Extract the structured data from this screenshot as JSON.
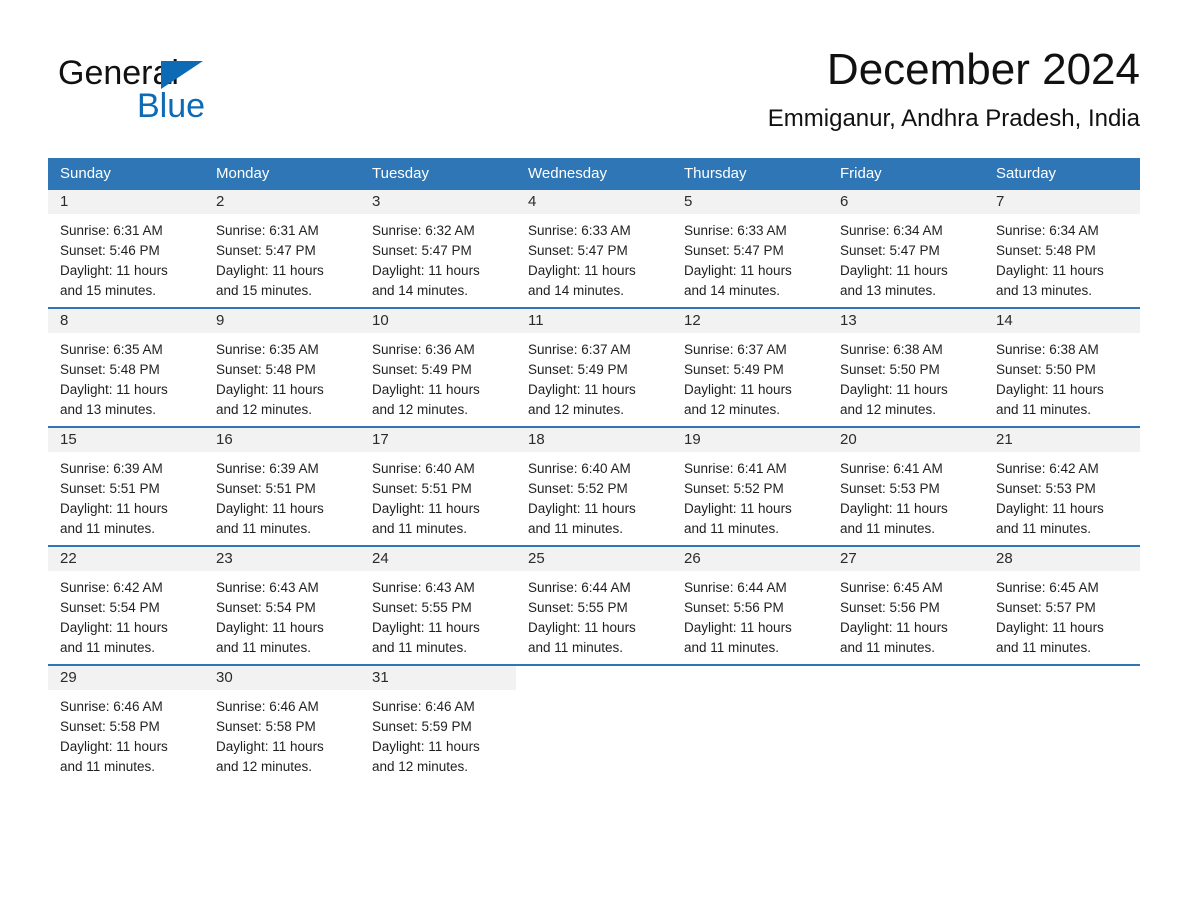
{
  "brand": {
    "line1": "General",
    "line2": "Blue",
    "triangle_color": "#0d6ab5"
  },
  "header": {
    "title": "December 2024",
    "subtitle": "Emmiganur, Andhra Pradesh, India"
  },
  "theme": {
    "header_blue": "#2e76b6",
    "daynum_band": "#f2f2f2",
    "text": "#1f1f1f"
  },
  "weekdays": [
    "Sunday",
    "Monday",
    "Tuesday",
    "Wednesday",
    "Thursday",
    "Friday",
    "Saturday"
  ],
  "weeks": [
    [
      {
        "day": "1",
        "sunrise": "Sunrise: 6:31 AM",
        "sunset": "Sunset: 5:46 PM",
        "daylight1": "Daylight: 11 hours",
        "daylight2": "and 15 minutes."
      },
      {
        "day": "2",
        "sunrise": "Sunrise: 6:31 AM",
        "sunset": "Sunset: 5:47 PM",
        "daylight1": "Daylight: 11 hours",
        "daylight2": "and 15 minutes."
      },
      {
        "day": "3",
        "sunrise": "Sunrise: 6:32 AM",
        "sunset": "Sunset: 5:47 PM",
        "daylight1": "Daylight: 11 hours",
        "daylight2": "and 14 minutes."
      },
      {
        "day": "4",
        "sunrise": "Sunrise: 6:33 AM",
        "sunset": "Sunset: 5:47 PM",
        "daylight1": "Daylight: 11 hours",
        "daylight2": "and 14 minutes."
      },
      {
        "day": "5",
        "sunrise": "Sunrise: 6:33 AM",
        "sunset": "Sunset: 5:47 PM",
        "daylight1": "Daylight: 11 hours",
        "daylight2": "and 14 minutes."
      },
      {
        "day": "6",
        "sunrise": "Sunrise: 6:34 AM",
        "sunset": "Sunset: 5:47 PM",
        "daylight1": "Daylight: 11 hours",
        "daylight2": "and 13 minutes."
      },
      {
        "day": "7",
        "sunrise": "Sunrise: 6:34 AM",
        "sunset": "Sunset: 5:48 PM",
        "daylight1": "Daylight: 11 hours",
        "daylight2": "and 13 minutes."
      }
    ],
    [
      {
        "day": "8",
        "sunrise": "Sunrise: 6:35 AM",
        "sunset": "Sunset: 5:48 PM",
        "daylight1": "Daylight: 11 hours",
        "daylight2": "and 13 minutes."
      },
      {
        "day": "9",
        "sunrise": "Sunrise: 6:35 AM",
        "sunset": "Sunset: 5:48 PM",
        "daylight1": "Daylight: 11 hours",
        "daylight2": "and 12 minutes."
      },
      {
        "day": "10",
        "sunrise": "Sunrise: 6:36 AM",
        "sunset": "Sunset: 5:49 PM",
        "daylight1": "Daylight: 11 hours",
        "daylight2": "and 12 minutes."
      },
      {
        "day": "11",
        "sunrise": "Sunrise: 6:37 AM",
        "sunset": "Sunset: 5:49 PM",
        "daylight1": "Daylight: 11 hours",
        "daylight2": "and 12 minutes."
      },
      {
        "day": "12",
        "sunrise": "Sunrise: 6:37 AM",
        "sunset": "Sunset: 5:49 PM",
        "daylight1": "Daylight: 11 hours",
        "daylight2": "and 12 minutes."
      },
      {
        "day": "13",
        "sunrise": "Sunrise: 6:38 AM",
        "sunset": "Sunset: 5:50 PM",
        "daylight1": "Daylight: 11 hours",
        "daylight2": "and 12 minutes."
      },
      {
        "day": "14",
        "sunrise": "Sunrise: 6:38 AM",
        "sunset": "Sunset: 5:50 PM",
        "daylight1": "Daylight: 11 hours",
        "daylight2": "and 11 minutes."
      }
    ],
    [
      {
        "day": "15",
        "sunrise": "Sunrise: 6:39 AM",
        "sunset": "Sunset: 5:51 PM",
        "daylight1": "Daylight: 11 hours",
        "daylight2": "and 11 minutes."
      },
      {
        "day": "16",
        "sunrise": "Sunrise: 6:39 AM",
        "sunset": "Sunset: 5:51 PM",
        "daylight1": "Daylight: 11 hours",
        "daylight2": "and 11 minutes."
      },
      {
        "day": "17",
        "sunrise": "Sunrise: 6:40 AM",
        "sunset": "Sunset: 5:51 PM",
        "daylight1": "Daylight: 11 hours",
        "daylight2": "and 11 minutes."
      },
      {
        "day": "18",
        "sunrise": "Sunrise: 6:40 AM",
        "sunset": "Sunset: 5:52 PM",
        "daylight1": "Daylight: 11 hours",
        "daylight2": "and 11 minutes."
      },
      {
        "day": "19",
        "sunrise": "Sunrise: 6:41 AM",
        "sunset": "Sunset: 5:52 PM",
        "daylight1": "Daylight: 11 hours",
        "daylight2": "and 11 minutes."
      },
      {
        "day": "20",
        "sunrise": "Sunrise: 6:41 AM",
        "sunset": "Sunset: 5:53 PM",
        "daylight1": "Daylight: 11 hours",
        "daylight2": "and 11 minutes."
      },
      {
        "day": "21",
        "sunrise": "Sunrise: 6:42 AM",
        "sunset": "Sunset: 5:53 PM",
        "daylight1": "Daylight: 11 hours",
        "daylight2": "and 11 minutes."
      }
    ],
    [
      {
        "day": "22",
        "sunrise": "Sunrise: 6:42 AM",
        "sunset": "Sunset: 5:54 PM",
        "daylight1": "Daylight: 11 hours",
        "daylight2": "and 11 minutes."
      },
      {
        "day": "23",
        "sunrise": "Sunrise: 6:43 AM",
        "sunset": "Sunset: 5:54 PM",
        "daylight1": "Daylight: 11 hours",
        "daylight2": "and 11 minutes."
      },
      {
        "day": "24",
        "sunrise": "Sunrise: 6:43 AM",
        "sunset": "Sunset: 5:55 PM",
        "daylight1": "Daylight: 11 hours",
        "daylight2": "and 11 minutes."
      },
      {
        "day": "25",
        "sunrise": "Sunrise: 6:44 AM",
        "sunset": "Sunset: 5:55 PM",
        "daylight1": "Daylight: 11 hours",
        "daylight2": "and 11 minutes."
      },
      {
        "day": "26",
        "sunrise": "Sunrise: 6:44 AM",
        "sunset": "Sunset: 5:56 PM",
        "daylight1": "Daylight: 11 hours",
        "daylight2": "and 11 minutes."
      },
      {
        "day": "27",
        "sunrise": "Sunrise: 6:45 AM",
        "sunset": "Sunset: 5:56 PM",
        "daylight1": "Daylight: 11 hours",
        "daylight2": "and 11 minutes."
      },
      {
        "day": "28",
        "sunrise": "Sunrise: 6:45 AM",
        "sunset": "Sunset: 5:57 PM",
        "daylight1": "Daylight: 11 hours",
        "daylight2": "and 11 minutes."
      }
    ],
    [
      {
        "day": "29",
        "sunrise": "Sunrise: 6:46 AM",
        "sunset": "Sunset: 5:58 PM",
        "daylight1": "Daylight: 11 hours",
        "daylight2": "and 11 minutes."
      },
      {
        "day": "30",
        "sunrise": "Sunrise: 6:46 AM",
        "sunset": "Sunset: 5:58 PM",
        "daylight1": "Daylight: 11 hours",
        "daylight2": "and 12 minutes."
      },
      {
        "day": "31",
        "sunrise": "Sunrise: 6:46 AM",
        "sunset": "Sunset: 5:59 PM",
        "daylight1": "Daylight: 11 hours",
        "daylight2": "and 12 minutes."
      },
      {
        "day": "",
        "sunrise": "",
        "sunset": "",
        "daylight1": "",
        "daylight2": ""
      },
      {
        "day": "",
        "sunrise": "",
        "sunset": "",
        "daylight1": "",
        "daylight2": ""
      },
      {
        "day": "",
        "sunrise": "",
        "sunset": "",
        "daylight1": "",
        "daylight2": ""
      },
      {
        "day": "",
        "sunrise": "",
        "sunset": "",
        "daylight1": "",
        "daylight2": ""
      }
    ]
  ]
}
